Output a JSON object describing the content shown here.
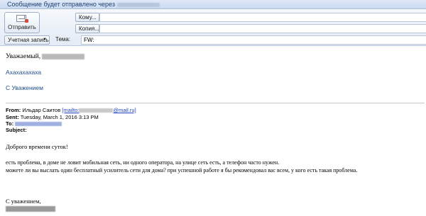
{
  "infobar": {
    "text": "Сообщение будет отправлено через"
  },
  "compose": {
    "send_label": "Отправить",
    "to_label": "Кому...",
    "cc_label": "Копия...",
    "account_label": "Учетная запись",
    "subject_label": "Тема:",
    "subject_value": "FW:"
  },
  "body": {
    "greeting": "Уважаемый,",
    "line1": "Ахахахахаха",
    "line2": "С Уважением",
    "from_label": "From:",
    "from_name": "Ильдар Саитов",
    "from_link": "[mailto:",
    "from_link_end": "@mail.ru]",
    "sent_label": "Sent:",
    "sent_value": "Tuesday, March 1, 2016 3:13 PM",
    "to_label": "To:",
    "subject_label": "Subject:",
    "p_greeting": "Доброго времени суток!",
    "p_problem": "есть проблема, в доме не ловит мобильная сеть, ни одного оператора, на улице сеть есть, а телефон часто нужен.",
    "p_question": "можете ли вы выслать один бесплатный усилитель сети для дома? при успешной работе я бы рекомендовал вас всем, у кого есть такая проблема.",
    "signoff": "С уважением,"
  }
}
